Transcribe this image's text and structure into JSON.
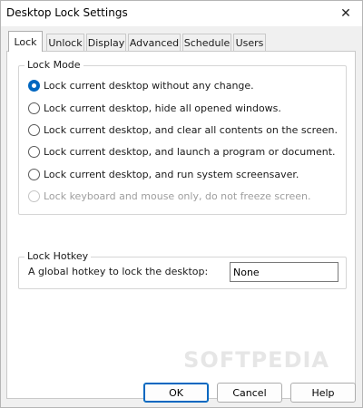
{
  "window": {
    "title": "Desktop Lock Settings",
    "close_symbol": "✕"
  },
  "tabs": [
    {
      "label": "Lock",
      "active": true
    },
    {
      "label": "Unlock",
      "active": false
    },
    {
      "label": "Display",
      "active": false
    },
    {
      "label": "Advanced",
      "active": false
    },
    {
      "label": "Schedule",
      "active": false
    },
    {
      "label": "Users",
      "active": false
    }
  ],
  "lock_mode": {
    "group_label": "Lock Mode",
    "options": [
      {
        "label": "Lock current desktop without any change.",
        "checked": true,
        "disabled": false
      },
      {
        "label": "Lock current desktop, hide all opened windows.",
        "checked": false,
        "disabled": false
      },
      {
        "label": "Lock current desktop, and clear all contents on the screen.",
        "checked": false,
        "disabled": false
      },
      {
        "label": "Lock current desktop, and launch a program or document.",
        "checked": false,
        "disabled": false
      },
      {
        "label": "Lock current desktop, and run system screensaver.",
        "checked": false,
        "disabled": false
      },
      {
        "label": "Lock keyboard and mouse only, do not freeze screen.",
        "checked": false,
        "disabled": true
      }
    ]
  },
  "lock_hotkey": {
    "group_label": "Lock Hotkey",
    "label": "A global hotkey to lock the desktop:",
    "value": "None"
  },
  "buttons": {
    "ok": "OK",
    "cancel": "Cancel",
    "help": "Help"
  },
  "watermark": "SOFTPEDIA"
}
